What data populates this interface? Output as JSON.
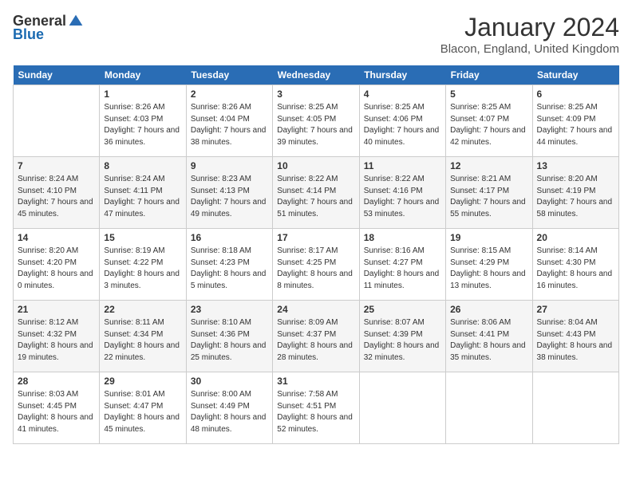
{
  "logo": {
    "general": "General",
    "blue": "Blue"
  },
  "title": "January 2024",
  "location": "Blacon, England, United Kingdom",
  "days_of_week": [
    "Sunday",
    "Monday",
    "Tuesday",
    "Wednesday",
    "Thursday",
    "Friday",
    "Saturday"
  ],
  "weeks": [
    [
      {
        "day": "",
        "sunrise": "",
        "sunset": "",
        "daylight": ""
      },
      {
        "day": "1",
        "sunrise": "Sunrise: 8:26 AM",
        "sunset": "Sunset: 4:03 PM",
        "daylight": "Daylight: 7 hours and 36 minutes."
      },
      {
        "day": "2",
        "sunrise": "Sunrise: 8:26 AM",
        "sunset": "Sunset: 4:04 PM",
        "daylight": "Daylight: 7 hours and 38 minutes."
      },
      {
        "day": "3",
        "sunrise": "Sunrise: 8:25 AM",
        "sunset": "Sunset: 4:05 PM",
        "daylight": "Daylight: 7 hours and 39 minutes."
      },
      {
        "day": "4",
        "sunrise": "Sunrise: 8:25 AM",
        "sunset": "Sunset: 4:06 PM",
        "daylight": "Daylight: 7 hours and 40 minutes."
      },
      {
        "day": "5",
        "sunrise": "Sunrise: 8:25 AM",
        "sunset": "Sunset: 4:07 PM",
        "daylight": "Daylight: 7 hours and 42 minutes."
      },
      {
        "day": "6",
        "sunrise": "Sunrise: 8:25 AM",
        "sunset": "Sunset: 4:09 PM",
        "daylight": "Daylight: 7 hours and 44 minutes."
      }
    ],
    [
      {
        "day": "7",
        "sunrise": "Sunrise: 8:24 AM",
        "sunset": "Sunset: 4:10 PM",
        "daylight": "Daylight: 7 hours and 45 minutes."
      },
      {
        "day": "8",
        "sunrise": "Sunrise: 8:24 AM",
        "sunset": "Sunset: 4:11 PM",
        "daylight": "Daylight: 7 hours and 47 minutes."
      },
      {
        "day": "9",
        "sunrise": "Sunrise: 8:23 AM",
        "sunset": "Sunset: 4:13 PM",
        "daylight": "Daylight: 7 hours and 49 minutes."
      },
      {
        "day": "10",
        "sunrise": "Sunrise: 8:22 AM",
        "sunset": "Sunset: 4:14 PM",
        "daylight": "Daylight: 7 hours and 51 minutes."
      },
      {
        "day": "11",
        "sunrise": "Sunrise: 8:22 AM",
        "sunset": "Sunset: 4:16 PM",
        "daylight": "Daylight: 7 hours and 53 minutes."
      },
      {
        "day": "12",
        "sunrise": "Sunrise: 8:21 AM",
        "sunset": "Sunset: 4:17 PM",
        "daylight": "Daylight: 7 hours and 55 minutes."
      },
      {
        "day": "13",
        "sunrise": "Sunrise: 8:20 AM",
        "sunset": "Sunset: 4:19 PM",
        "daylight": "Daylight: 7 hours and 58 minutes."
      }
    ],
    [
      {
        "day": "14",
        "sunrise": "Sunrise: 8:20 AM",
        "sunset": "Sunset: 4:20 PM",
        "daylight": "Daylight: 8 hours and 0 minutes."
      },
      {
        "day": "15",
        "sunrise": "Sunrise: 8:19 AM",
        "sunset": "Sunset: 4:22 PM",
        "daylight": "Daylight: 8 hours and 3 minutes."
      },
      {
        "day": "16",
        "sunrise": "Sunrise: 8:18 AM",
        "sunset": "Sunset: 4:23 PM",
        "daylight": "Daylight: 8 hours and 5 minutes."
      },
      {
        "day": "17",
        "sunrise": "Sunrise: 8:17 AM",
        "sunset": "Sunset: 4:25 PM",
        "daylight": "Daylight: 8 hours and 8 minutes."
      },
      {
        "day": "18",
        "sunrise": "Sunrise: 8:16 AM",
        "sunset": "Sunset: 4:27 PM",
        "daylight": "Daylight: 8 hours and 11 minutes."
      },
      {
        "day": "19",
        "sunrise": "Sunrise: 8:15 AM",
        "sunset": "Sunset: 4:29 PM",
        "daylight": "Daylight: 8 hours and 13 minutes."
      },
      {
        "day": "20",
        "sunrise": "Sunrise: 8:14 AM",
        "sunset": "Sunset: 4:30 PM",
        "daylight": "Daylight: 8 hours and 16 minutes."
      }
    ],
    [
      {
        "day": "21",
        "sunrise": "Sunrise: 8:12 AM",
        "sunset": "Sunset: 4:32 PM",
        "daylight": "Daylight: 8 hours and 19 minutes."
      },
      {
        "day": "22",
        "sunrise": "Sunrise: 8:11 AM",
        "sunset": "Sunset: 4:34 PM",
        "daylight": "Daylight: 8 hours and 22 minutes."
      },
      {
        "day": "23",
        "sunrise": "Sunrise: 8:10 AM",
        "sunset": "Sunset: 4:36 PM",
        "daylight": "Daylight: 8 hours and 25 minutes."
      },
      {
        "day": "24",
        "sunrise": "Sunrise: 8:09 AM",
        "sunset": "Sunset: 4:37 PM",
        "daylight": "Daylight: 8 hours and 28 minutes."
      },
      {
        "day": "25",
        "sunrise": "Sunrise: 8:07 AM",
        "sunset": "Sunset: 4:39 PM",
        "daylight": "Daylight: 8 hours and 32 minutes."
      },
      {
        "day": "26",
        "sunrise": "Sunrise: 8:06 AM",
        "sunset": "Sunset: 4:41 PM",
        "daylight": "Daylight: 8 hours and 35 minutes."
      },
      {
        "day": "27",
        "sunrise": "Sunrise: 8:04 AM",
        "sunset": "Sunset: 4:43 PM",
        "daylight": "Daylight: 8 hours and 38 minutes."
      }
    ],
    [
      {
        "day": "28",
        "sunrise": "Sunrise: 8:03 AM",
        "sunset": "Sunset: 4:45 PM",
        "daylight": "Daylight: 8 hours and 41 minutes."
      },
      {
        "day": "29",
        "sunrise": "Sunrise: 8:01 AM",
        "sunset": "Sunset: 4:47 PM",
        "daylight": "Daylight: 8 hours and 45 minutes."
      },
      {
        "day": "30",
        "sunrise": "Sunrise: 8:00 AM",
        "sunset": "Sunset: 4:49 PM",
        "daylight": "Daylight: 8 hours and 48 minutes."
      },
      {
        "day": "31",
        "sunrise": "Sunrise: 7:58 AM",
        "sunset": "Sunset: 4:51 PM",
        "daylight": "Daylight: 8 hours and 52 minutes."
      },
      {
        "day": "",
        "sunrise": "",
        "sunset": "",
        "daylight": ""
      },
      {
        "day": "",
        "sunrise": "",
        "sunset": "",
        "daylight": ""
      },
      {
        "day": "",
        "sunrise": "",
        "sunset": "",
        "daylight": ""
      }
    ]
  ]
}
